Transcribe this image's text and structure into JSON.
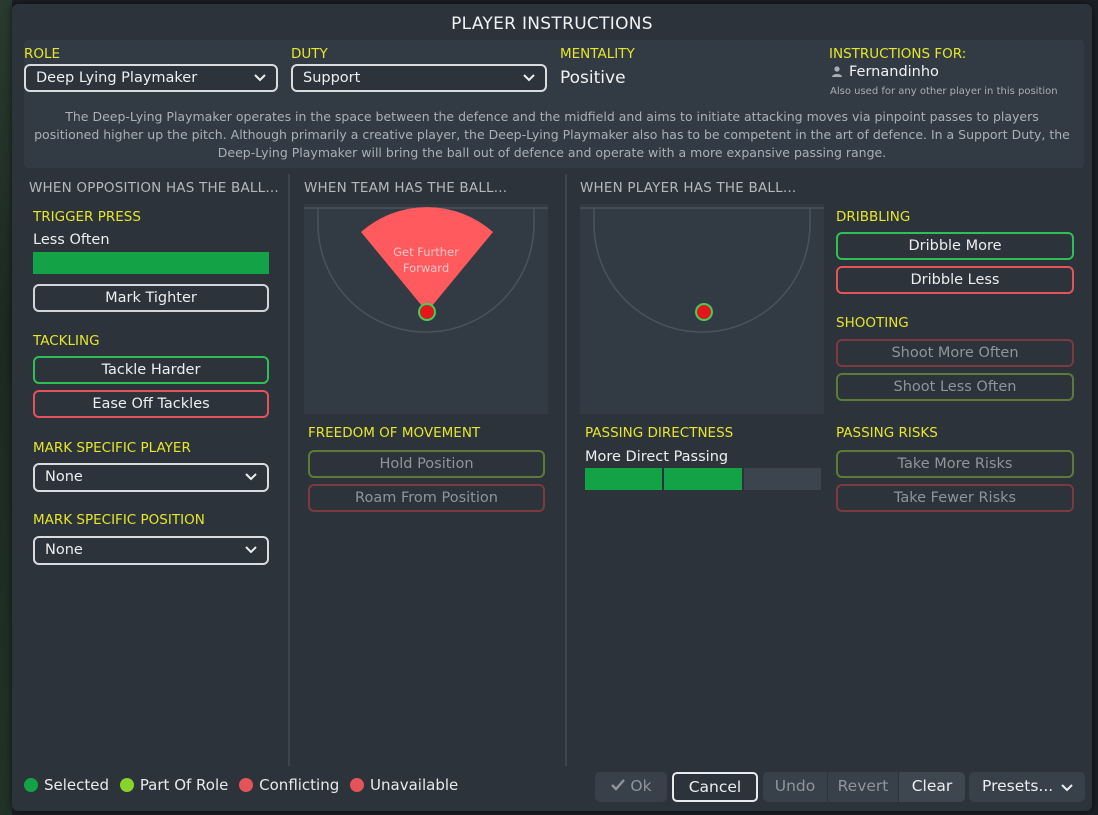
{
  "title": "PLAYER INSTRUCTIONS",
  "header": {
    "role_label": "ROLE",
    "role_value": "Deep Lying Playmaker",
    "duty_label": "DUTY",
    "duty_value": "Support",
    "mentality_label": "MENTALITY",
    "mentality_value": "Positive",
    "instructions_for_label": "INSTRUCTIONS FOR:",
    "player_name": "Fernandinho",
    "also_used": "Also used for any other player in this position",
    "description": "The Deep-Lying Playmaker operates in the space between the defence and the midfield and aims to initiate attacking moves via pinpoint passes to players positioned higher up the pitch. Although primarily a creative player, the Deep-Lying Playmaker also has to be competent in the art of defence. In a Support Duty, the Deep-Lying Playmaker will bring the ball out of defence and operate with a more expansive passing range."
  },
  "opposition": {
    "heading": "WHEN OPPOSITION HAS THE BALL...",
    "trigger_press_label": "TRIGGER PRESS",
    "trigger_press_value": "Less Often",
    "trigger_press_level": 1.0,
    "mark_tighter": "Mark Tighter",
    "tackling_label": "TACKLING",
    "tackle_harder": "Tackle Harder",
    "ease_off_tackles": "Ease Off Tackles",
    "mark_player_label": "MARK SPECIFIC PLAYER",
    "mark_player_value": "None",
    "mark_position_label": "MARK SPECIFIC POSITION",
    "mark_position_value": "None"
  },
  "team": {
    "heading": "WHEN TEAM HAS THE BALL...",
    "pitch_zone_label_1": "Get Further",
    "pitch_zone_label_2": "Forward",
    "freedom_label": "FREEDOM OF MOVEMENT",
    "hold_position": "Hold Position",
    "roam_from_position": "Roam From Position"
  },
  "player": {
    "heading": "WHEN PLAYER HAS THE BALL...",
    "dribbling_label": "DRIBBLING",
    "dribble_more": "Dribble More",
    "dribble_less": "Dribble Less",
    "shooting_label": "SHOOTING",
    "shoot_more": "Shoot More Often",
    "shoot_less": "Shoot Less Often",
    "passing_directness_label": "PASSING DIRECTNESS",
    "passing_directness_value": "More Direct Passing",
    "passing_directness_steps_filled": 2,
    "passing_directness_steps_total": 3,
    "passing_risks_label": "PASSING RISKS",
    "take_more_risks": "Take More Risks",
    "take_fewer_risks": "Take Fewer Risks"
  },
  "legend": {
    "selected": "Selected",
    "part_of_role": "Part Of Role",
    "conflicting": "Conflicting",
    "unavailable": "Unavailable"
  },
  "footer": {
    "ok": "Ok",
    "cancel": "Cancel",
    "undo": "Undo",
    "revert": "Revert",
    "clear": "Clear",
    "presets": "Presets..."
  },
  "colors": {
    "selected": "#14a246",
    "part_of_role": "#8ad32a",
    "conflicting": "#e5535a",
    "unavailable": "#e5535a",
    "accent_yellow": "#e6e62a"
  }
}
